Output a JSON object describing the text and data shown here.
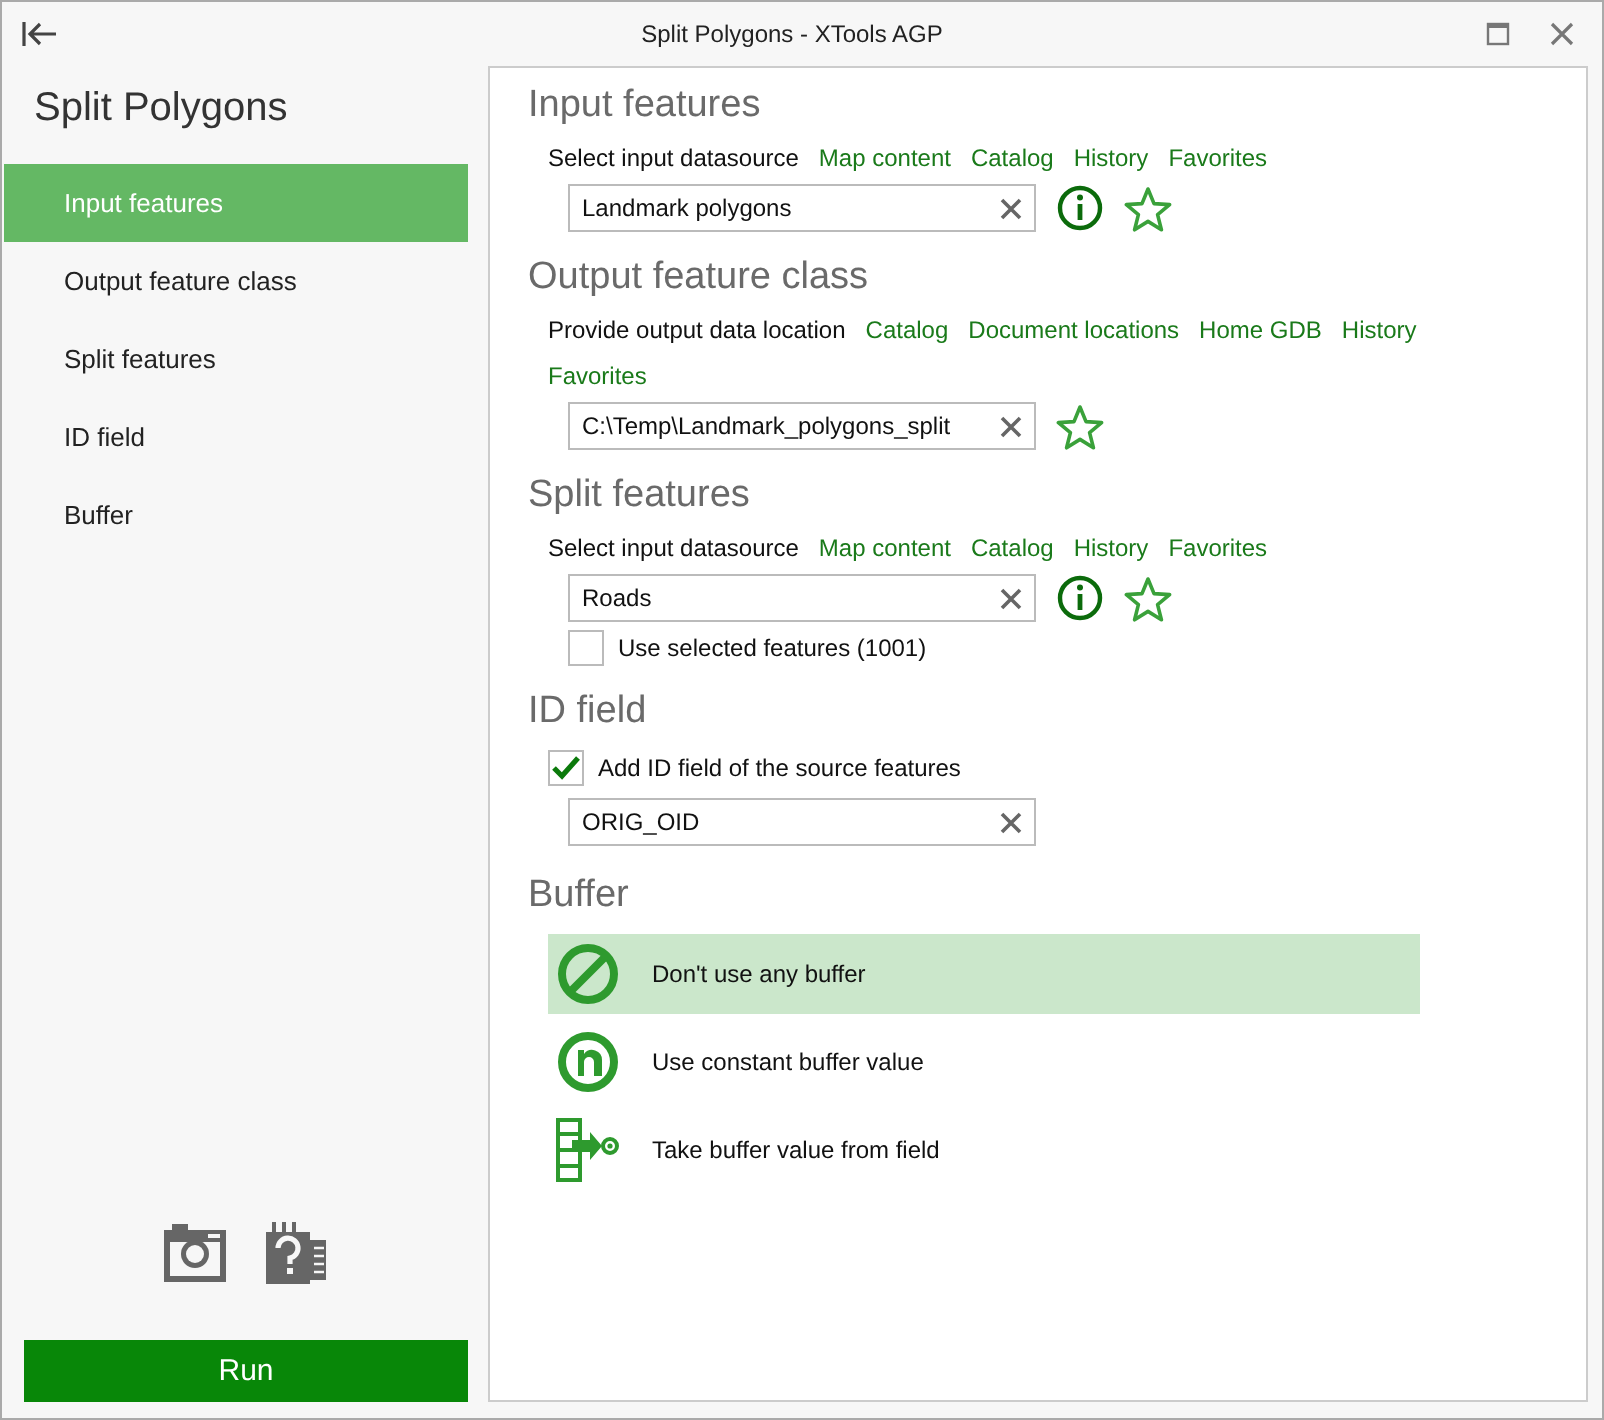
{
  "window": {
    "title": "Split Polygons  -  XTools AGP"
  },
  "sidebar": {
    "title": "Split Polygons",
    "items": [
      {
        "label": "Input features",
        "selected": true
      },
      {
        "label": "Output feature class",
        "selected": false
      },
      {
        "label": "Split features",
        "selected": false
      },
      {
        "label": "ID field",
        "selected": false
      },
      {
        "label": "Buffer",
        "selected": false
      }
    ],
    "run_button": "Run"
  },
  "input_features": {
    "title": "Input features",
    "source_label": "Select input datasource",
    "links": [
      "Map content",
      "Catalog",
      "History",
      "Favorites"
    ],
    "value": "Landmark polygons"
  },
  "output_feature_class": {
    "title": "Output feature class",
    "source_label": "Provide output data location",
    "links": [
      "Catalog",
      "Document locations",
      "Home GDB",
      "History",
      "Favorites"
    ],
    "value": "C:\\Temp\\Landmark_polygons_split"
  },
  "split_features": {
    "title": "Split features",
    "source_label": "Select input datasource",
    "links": [
      "Map content",
      "Catalog",
      "History",
      "Favorites"
    ],
    "value": "Roads",
    "use_selected": {
      "label": "Use selected features (1001)",
      "checked": false
    }
  },
  "id_field": {
    "title": "ID field",
    "add_id": {
      "label": "Add ID field of the source features",
      "checked": true
    },
    "value": "ORIG_OID"
  },
  "buffer": {
    "title": "Buffer",
    "options": [
      {
        "kind": "none",
        "label": "Don't use any buffer",
        "selected": true
      },
      {
        "kind": "constant",
        "label": "Use constant buffer value",
        "selected": false
      },
      {
        "kind": "field",
        "label": "Take buffer value from field",
        "selected": false
      }
    ]
  }
}
